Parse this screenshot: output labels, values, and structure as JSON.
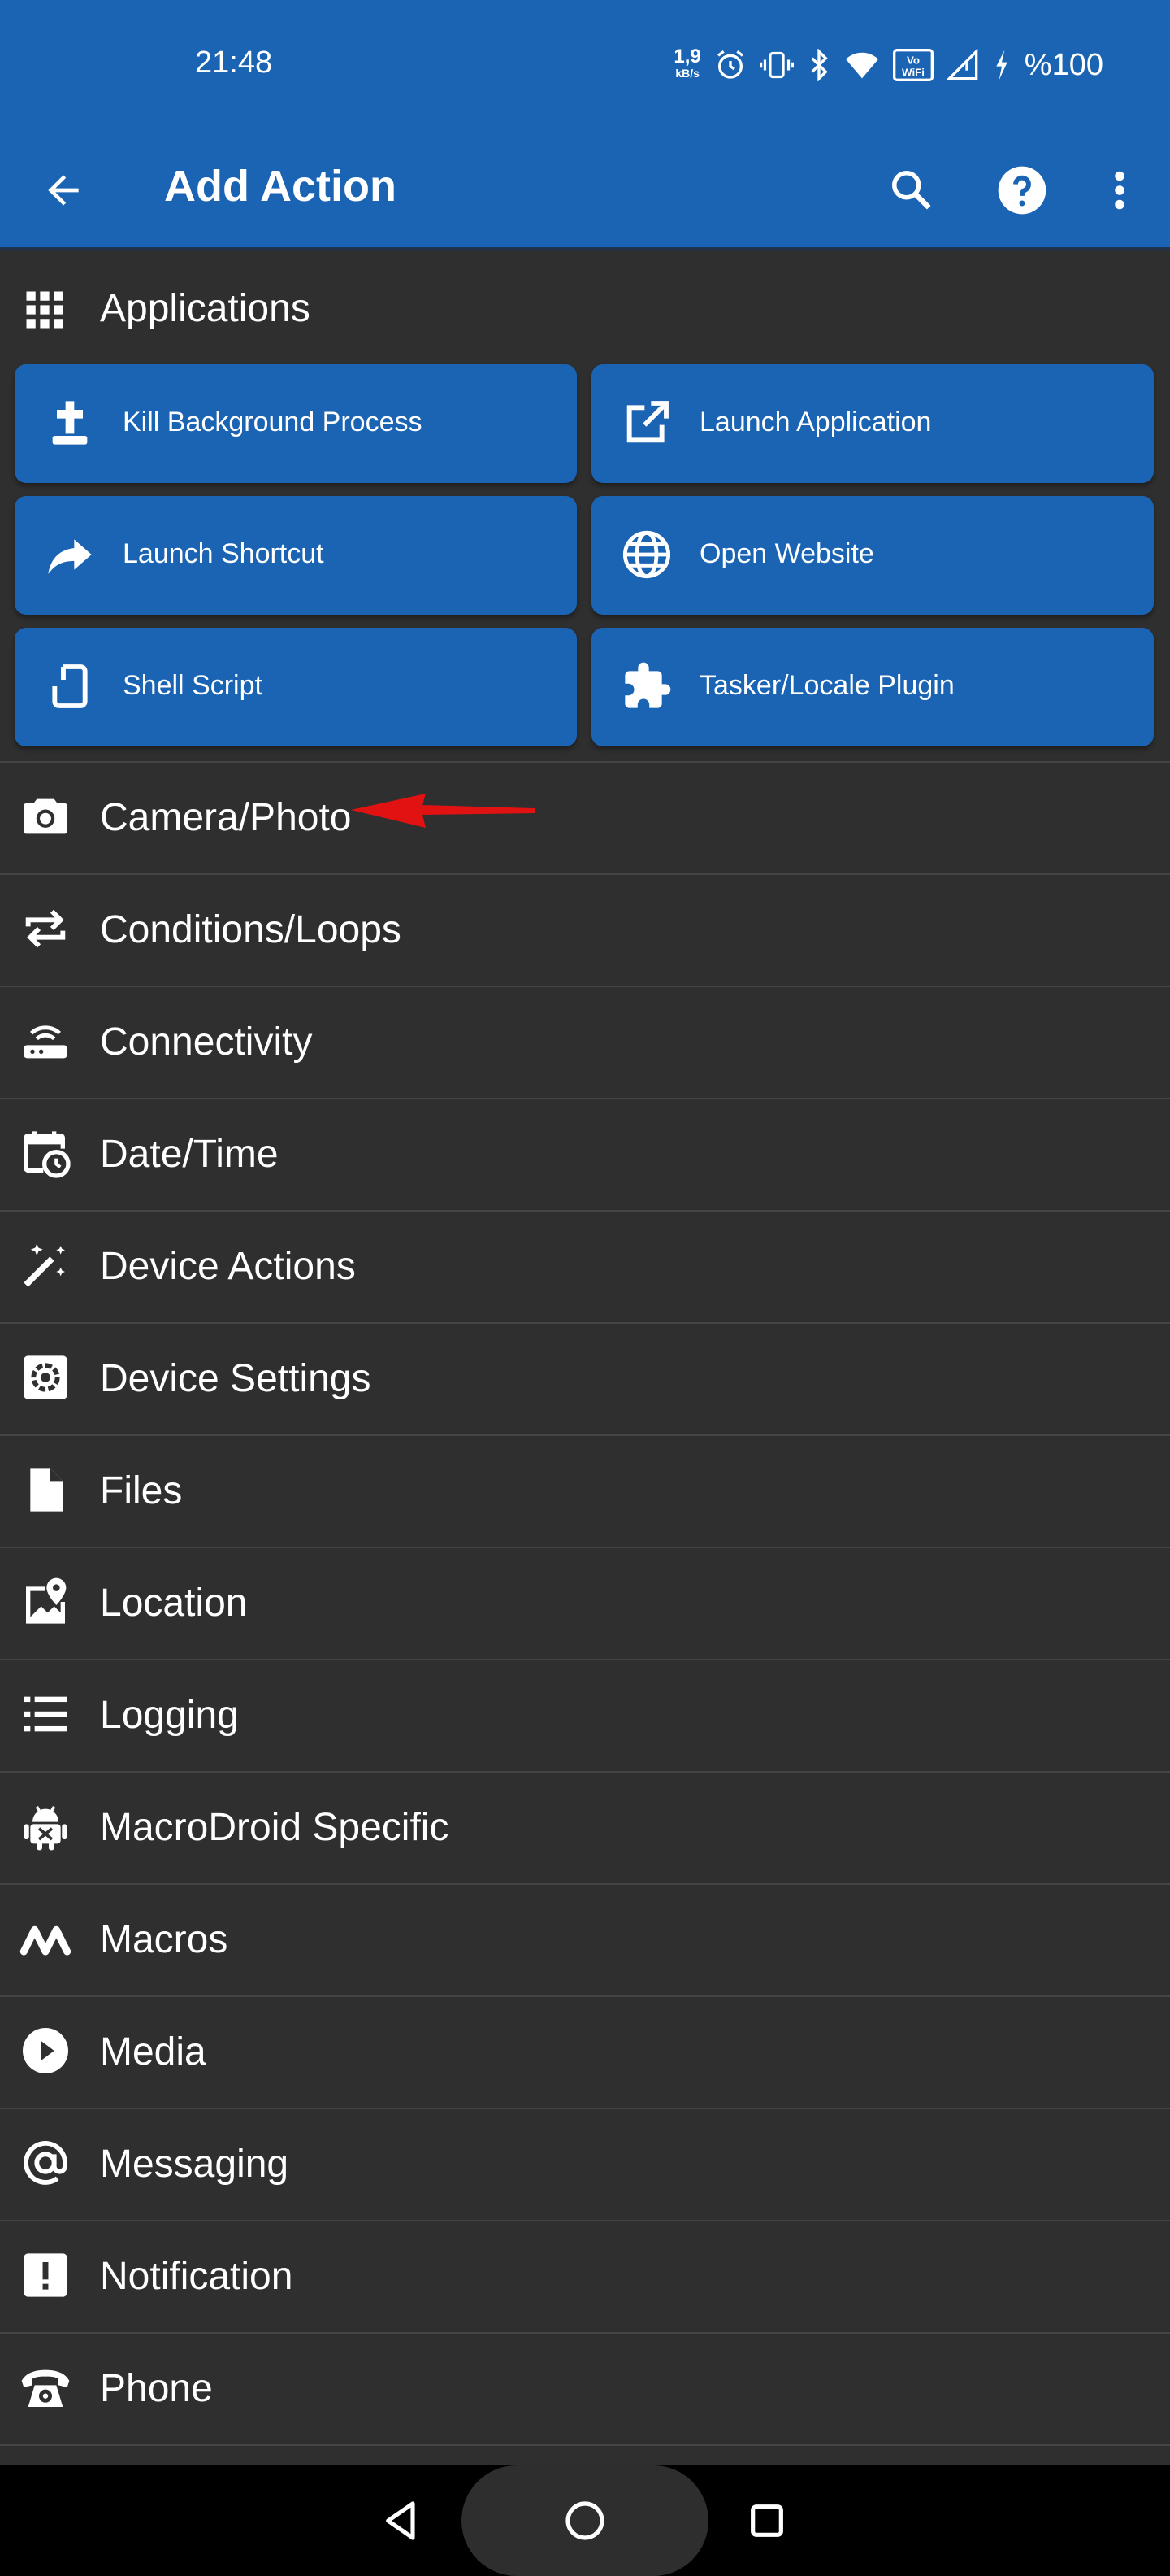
{
  "status_bar": {
    "time": "21:48",
    "net_speed_value": "1,9",
    "net_speed_unit": "kB/s",
    "battery": "%100",
    "icons": [
      "alarm-icon",
      "vibrate-icon",
      "bluetooth-icon",
      "wifi-icon",
      "vowifi-icon",
      "signal-icon",
      "charging-icon"
    ]
  },
  "toolbar": {
    "title": "Add Action",
    "back_icon": "arrow-back-icon",
    "search_icon": "search-icon",
    "help_icon": "help-icon",
    "more_icon": "more-vert-icon"
  },
  "section": {
    "title": "Applications",
    "icon": "apps-grid-icon"
  },
  "tiles": [
    {
      "label": "Kill Background Process",
      "icon": "grave-cross-icon"
    },
    {
      "label": "Launch Application",
      "icon": "open-in-new-icon"
    },
    {
      "label": "Launch Shortcut",
      "icon": "share-arrow-icon"
    },
    {
      "label": "Open Website",
      "icon": "globe-icon"
    },
    {
      "label": "Shell Script",
      "icon": "shell-phone-icon"
    },
    {
      "label": "Tasker/Locale Plugin",
      "icon": "puzzle-icon"
    }
  ],
  "categories": [
    {
      "label": "Camera/Photo",
      "icon": "camera-icon"
    },
    {
      "label": "Conditions/Loops",
      "icon": "repeat-icon"
    },
    {
      "label": "Connectivity",
      "icon": "router-icon"
    },
    {
      "label": "Date/Time",
      "icon": "calendar-clock-icon"
    },
    {
      "label": "Device Actions",
      "icon": "magic-wand-icon"
    },
    {
      "label": "Device Settings",
      "icon": "settings-gear-icon"
    },
    {
      "label": "Files",
      "icon": "file-icon"
    },
    {
      "label": "Location",
      "icon": "map-pin-icon"
    },
    {
      "label": "Logging",
      "icon": "list-icon"
    },
    {
      "label": "MacroDroid Specific",
      "icon": "android-robot-icon"
    },
    {
      "label": "Macros",
      "icon": "macrodroid-logo-icon"
    },
    {
      "label": "Media",
      "icon": "play-circle-icon"
    },
    {
      "label": "Messaging",
      "icon": "at-sign-icon"
    },
    {
      "label": "Notification",
      "icon": "alert-box-icon"
    },
    {
      "label": "Phone",
      "icon": "phone-classic-icon"
    }
  ],
  "annotation": {
    "icon": "red-arrow-pointer"
  },
  "nav_bar": {
    "back": "nav-back-icon",
    "home": "nav-home-icon",
    "recents": "nav-recents-icon"
  },
  "colors": {
    "primary": "#1a64b3",
    "background": "#2f2f2f",
    "divider": "#454545",
    "annotation_red": "#e01212"
  }
}
